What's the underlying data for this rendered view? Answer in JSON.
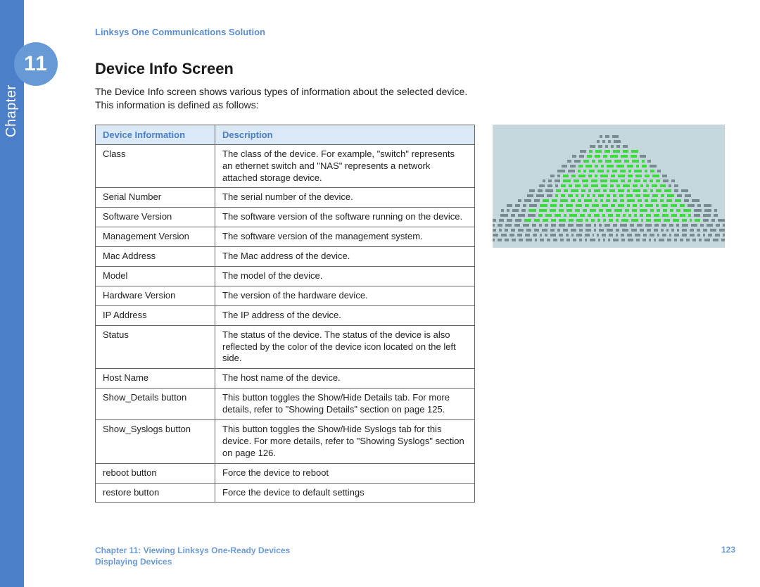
{
  "sidebar": {
    "chapter_label": "Chapter",
    "chapter_number": "11"
  },
  "header": {
    "doc_subtitle": "Linksys One Communications Solution"
  },
  "section": {
    "title": "Device Info Screen",
    "intro": "The Device Info screen shows various types of information about the selected device. This information is defined as follows:"
  },
  "table": {
    "headers": {
      "col1": "Device Information",
      "col2": "Description"
    },
    "rows": [
      {
        "name": "Class",
        "desc": "The class of the device. For example, \"switch\" represents an ethernet switch and \"NAS\" represents a network attached storage device."
      },
      {
        "name": "Serial Number",
        "desc": "The serial number of the device."
      },
      {
        "name": "Software Version",
        "desc": "The software version of the software running on the device."
      },
      {
        "name": "Management Version",
        "desc": "The software version of the management system."
      },
      {
        "name": "Mac Address",
        "desc": "The Mac address of the device."
      },
      {
        "name": "Model",
        "desc": "The model of the device."
      },
      {
        "name": "Hardware Version",
        "desc": "The version of the hardware device."
      },
      {
        "name": "IP Address",
        "desc": "The IP address of the device."
      },
      {
        "name": "Status",
        "desc": "The status of the device. The status of the device is also reflected by the color of the device icon located on the left side."
      },
      {
        "name": "Host Name",
        "desc": "The host name of the device."
      },
      {
        "name": "Show_Details button",
        "desc": "This button toggles the Show/Hide Details tab. For more details, refer to \"Showing Details\" section on page 125."
      },
      {
        "name": "Show_Syslogs button",
        "desc": "This button toggles the Show/Hide Syslogs tab for this device. For more details, refer to \"Showing Syslogs\" section on page 126."
      },
      {
        "name": "reboot button",
        "desc": "Force the device to reboot"
      },
      {
        "name": "restore button",
        "desc": "Force the device to default settings"
      }
    ]
  },
  "footer": {
    "line1": "Chapter 11: Viewing Linksys One-Ready Devices",
    "line2": "Displaying Devices",
    "page": "123"
  }
}
